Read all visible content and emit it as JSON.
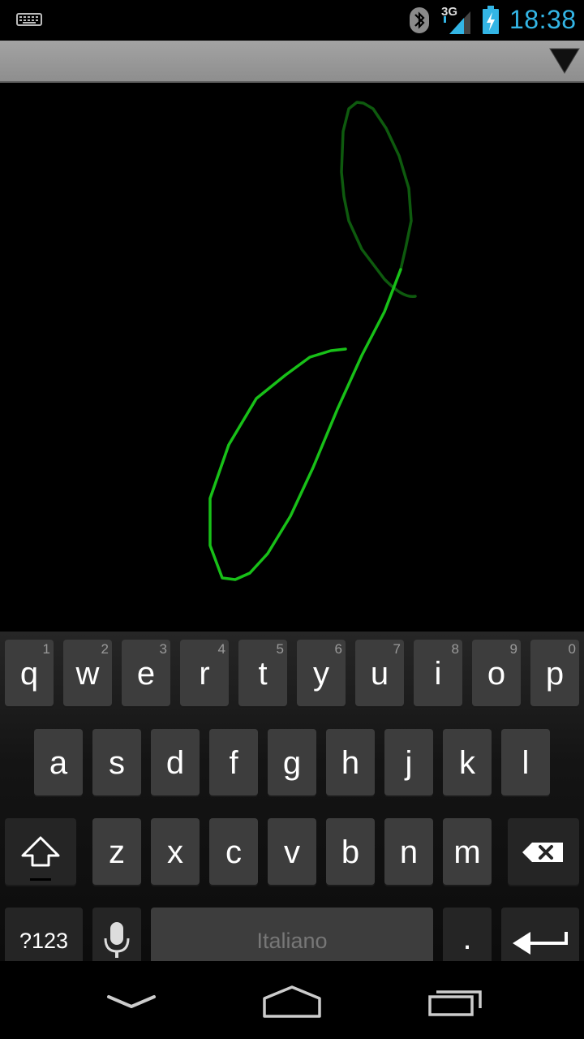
{
  "status_bar": {
    "time": "18:38",
    "network_label": "3G",
    "icons": [
      "keyboard-icon",
      "bluetooth-icon",
      "signal-icon",
      "battery-charging-icon"
    ],
    "time_color": "#33b5e5"
  },
  "action_bar": {
    "menu_icon": "dropdown-triangle-icon"
  },
  "canvas": {
    "stroke_color_bright": "#18c018",
    "stroke_color_faded": "#0d4d0d"
  },
  "keyboard": {
    "row1": [
      {
        "char": "q",
        "num": "1"
      },
      {
        "char": "w",
        "num": "2"
      },
      {
        "char": "e",
        "num": "3"
      },
      {
        "char": "r",
        "num": "4"
      },
      {
        "char": "t",
        "num": "5"
      },
      {
        "char": "y",
        "num": "6"
      },
      {
        "char": "u",
        "num": "7"
      },
      {
        "char": "i",
        "num": "8"
      },
      {
        "char": "o",
        "num": "9"
      },
      {
        "char": "p",
        "num": "0"
      }
    ],
    "row2": [
      "a",
      "s",
      "d",
      "f",
      "g",
      "h",
      "j",
      "k",
      "l"
    ],
    "row3": [
      "z",
      "x",
      "c",
      "v",
      "b",
      "n",
      "m"
    ],
    "symbols_label": "?123",
    "space_label": "Italiano",
    "period_label": "."
  },
  "nav_bar": {
    "icons": [
      "back-icon",
      "home-icon",
      "recents-icon"
    ]
  }
}
